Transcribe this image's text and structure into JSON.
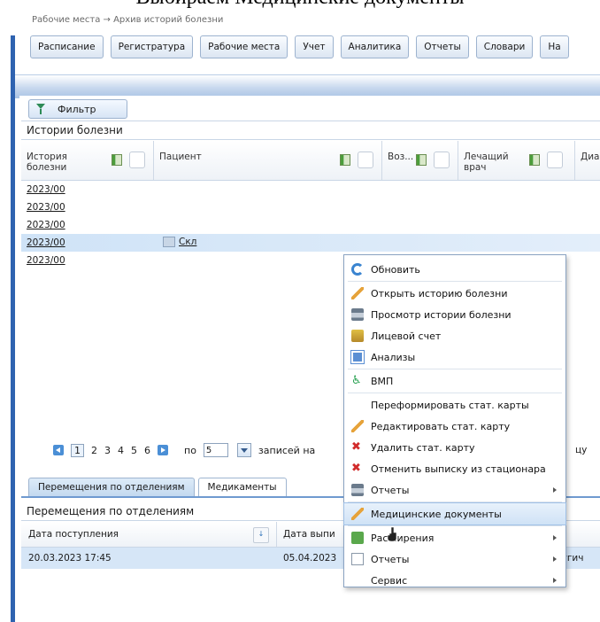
{
  "caption": "Выбираем Медицинские документы",
  "breadcrumb": "Рабочие места → Архив историй болезни",
  "top_nav": [
    "Расписание",
    "Регистратура",
    "Рабочие места",
    "Учет",
    "Аналитика",
    "Отчеты",
    "Словари",
    "На"
  ],
  "filter_label": "Фильтр",
  "panel_title": "Истории болезни",
  "columns": {
    "history": "История болезни",
    "patient": "Пациент",
    "age": "Воз...",
    "doctor": "Лечащий врач",
    "diag": "Диа"
  },
  "rows": [
    "2023/00",
    "2023/00",
    "2023/00",
    "2023/00",
    "2023/00"
  ],
  "selected_row": {
    "history": "2023/00",
    "patient": "Скл"
  },
  "pager": {
    "pages": [
      "1",
      "2",
      "3",
      "4",
      "5",
      "6"
    ],
    "current": "1",
    "per_label": "по",
    "size": "5",
    "records_label": "записей на",
    "tail": "цу"
  },
  "tabs": [
    "Перемещения по отделениям",
    "Медикаменты"
  ],
  "sub_panel_title": "Перемещения по отделениям",
  "sub_columns": {
    "admit": "Дата поступления",
    "discharge": "Дата выпи"
  },
  "sub_row": {
    "admit": "20.03.2023 17:45",
    "discharge": "05.04.2023",
    "dept": "ругич"
  },
  "context_menu": [
    {
      "label": "Обновить",
      "icon": "refresh-icon"
    },
    {
      "label": "Открыть историю болезни",
      "icon": "pencil-icon"
    },
    {
      "label": "Просмотр истории болезни",
      "icon": "printer-icon"
    },
    {
      "label": "Лицевой счет",
      "icon": "account-icon"
    },
    {
      "label": "Анализы",
      "icon": "copy-icon"
    },
    {
      "label": "ВМП",
      "icon": "vmp-icon"
    },
    {
      "label": "Переформировать стат. карты",
      "icon": ""
    },
    {
      "label": "Редактировать стат. карту",
      "icon": "pencil-icon"
    },
    {
      "label": "Удалить стат. карту",
      "icon": "delete-icon"
    },
    {
      "label": "Отменить выписку из стационара",
      "icon": "delete-icon"
    },
    {
      "label": "Отчеты",
      "icon": "printer-icon"
    },
    {
      "label": "Медицинские документы",
      "icon": "pencil-icon"
    },
    {
      "label": "Расширения",
      "icon": "extensions-icon"
    },
    {
      "label": "Отчеты",
      "icon": "document-icon"
    },
    {
      "label": "Сервис",
      "icon": ""
    }
  ]
}
